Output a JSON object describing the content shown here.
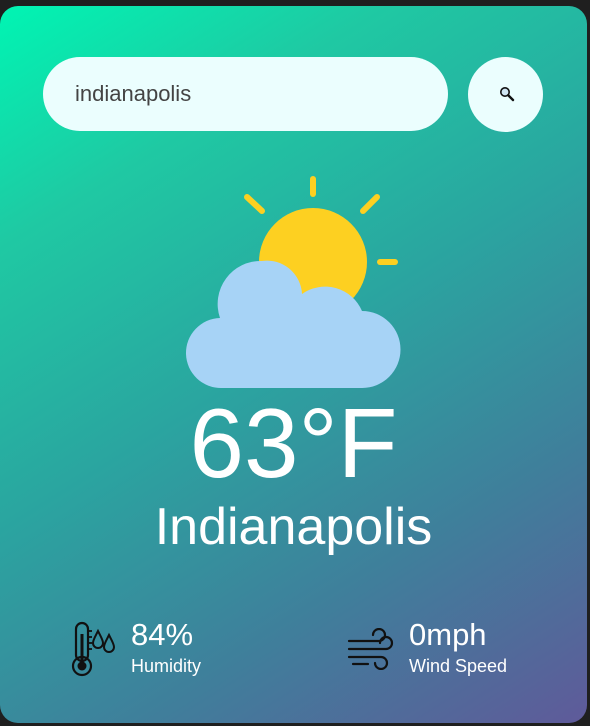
{
  "search": {
    "value": "indianapolis",
    "button_icon": "search-icon"
  },
  "weather": {
    "icon": "partly-cloudy-icon",
    "temperature": "63°F",
    "city": "Indianapolis"
  },
  "details": {
    "humidity": {
      "icon": "humidity-thermometer-icon",
      "value": "84%",
      "label": "Humidity"
    },
    "wind": {
      "icon": "wind-icon",
      "value": "0mph",
      "label": "Wind Speed"
    }
  },
  "colors": {
    "sun": "#fdd021",
    "cloud": "#a7d3f6",
    "card_panel": "#ebfefe",
    "gradient_start": "#00f5b3",
    "gradient_end": "#5f5a9a"
  }
}
